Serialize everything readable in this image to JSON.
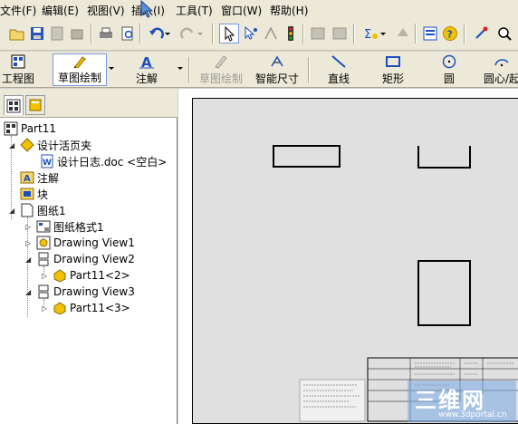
{
  "menu": {
    "items": [
      "文件(F)",
      "编辑(E)",
      "视图(V)",
      "插入(I)",
      "工具(T)",
      "窗口(W)",
      "帮助(H)"
    ]
  },
  "ribbon": {
    "engineering_label": "工程图",
    "sketch_label": "草图绘制",
    "annotation_label": "注解",
    "sketch_draw_label": "草图绘制",
    "smart_dim_label": "智能尺寸",
    "line_label": "直线",
    "rect_label": "矩形",
    "circle_label": "圆",
    "arc_label": "圆心/起"
  },
  "tree": {
    "root": "Part11",
    "design_binder": "设计活页夹",
    "design_log": "设计日志.doc <空白>",
    "annotations": "注解",
    "blocks": "块",
    "sheet": "图纸1",
    "sheet_format": "图纸格式1",
    "view1": "Drawing View1",
    "view2": "Drawing View2",
    "view2_part": "Part11<2>",
    "view3": "Drawing View3",
    "view3_part": "Part11<3>"
  },
  "watermark": {
    "logo_text": "三维网",
    "url": "www.3dportal.cn"
  },
  "colors": {
    "menu_bg": "#ece9d8",
    "sheet_bg": "#e0e0e0",
    "accent_blue": "#1b4fbf",
    "active_border": "#7a96df"
  }
}
